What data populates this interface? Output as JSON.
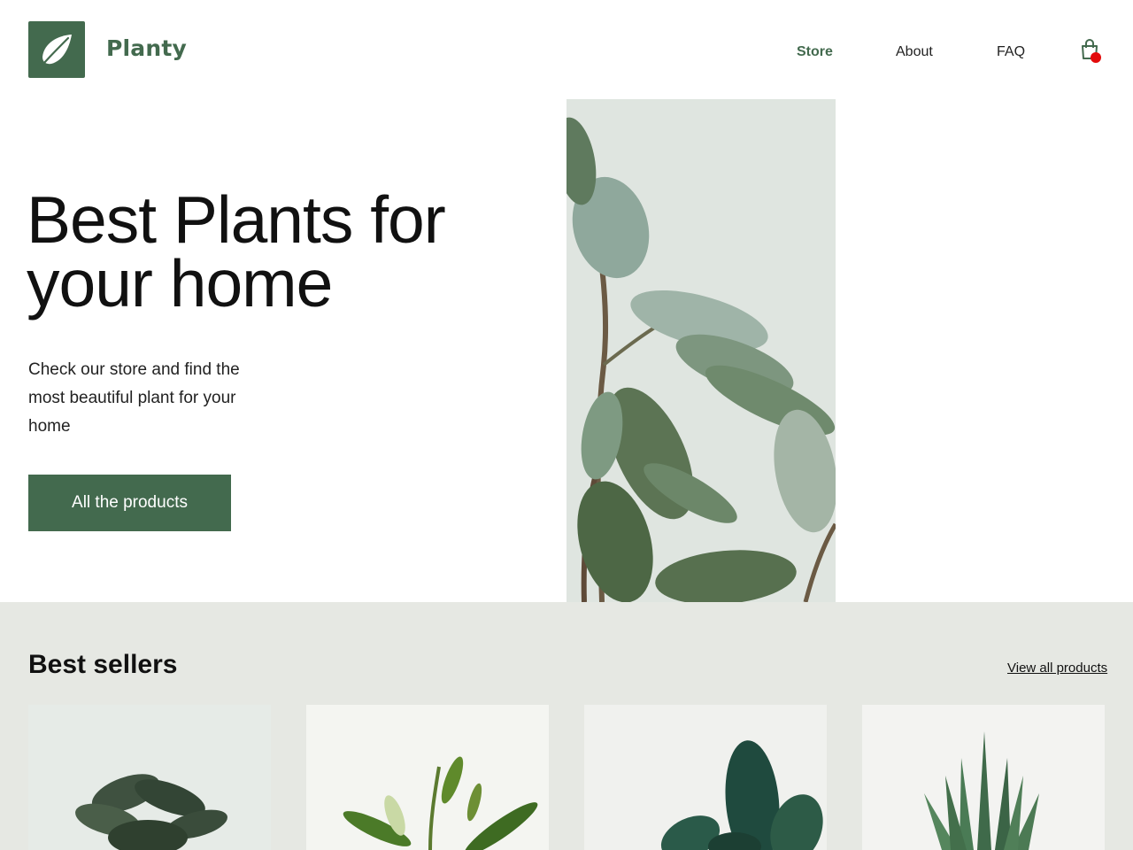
{
  "header": {
    "brand": "Planty",
    "logo_icon": "leaf-icon",
    "nav": [
      {
        "label": "Store",
        "active": true
      },
      {
        "label": "About",
        "active": false
      },
      {
        "label": "FAQ",
        "active": false
      }
    ],
    "cart_icon": "shopping-bag-icon",
    "cart_badge_color": "#e30b0b"
  },
  "hero": {
    "title_line1": "Best Plants for",
    "title_line2": "your home",
    "subtitle": "Check our store and find the most beautiful plant for your home",
    "cta_label": "All the products",
    "image": "rubber-plant-photo"
  },
  "best_sellers": {
    "title": "Best sellers",
    "view_all_label": "View all products",
    "products": [
      {
        "image": "calathea-plant-photo"
      },
      {
        "image": "lily-plant-photo"
      },
      {
        "image": "philodendron-plant-photo"
      },
      {
        "image": "aloe-plant-photo"
      }
    ]
  },
  "colors": {
    "brand_green": "#436a4e",
    "band_background": "#e6e8e3",
    "badge_red": "#e30b0b"
  }
}
